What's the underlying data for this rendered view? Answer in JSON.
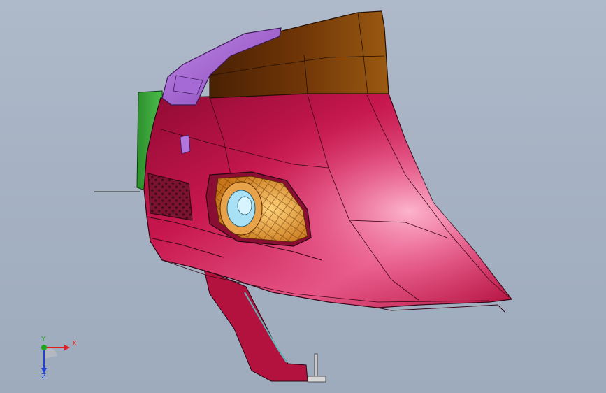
{
  "viewport": {
    "background": "#a9b5c6"
  },
  "model": {
    "parts": [
      {
        "name": "bumper-cover",
        "color": "#c2184f"
      },
      {
        "name": "upper-trim",
        "color": "#6b3208"
      },
      {
        "name": "bracket",
        "color": "#9b57c9"
      },
      {
        "name": "side-panel",
        "color": "#3ca93c"
      },
      {
        "name": "fog-lamp-bezel",
        "color": "#d9901f"
      },
      {
        "name": "fog-lamp-lens",
        "color": "#a8e0f5"
      }
    ]
  },
  "triad": {
    "x_label": "X",
    "y_label": "Y",
    "z_label": "Z",
    "x_color": "#e11d1d",
    "y_color": "#1ea51e",
    "z_color": "#1f3fd6"
  }
}
